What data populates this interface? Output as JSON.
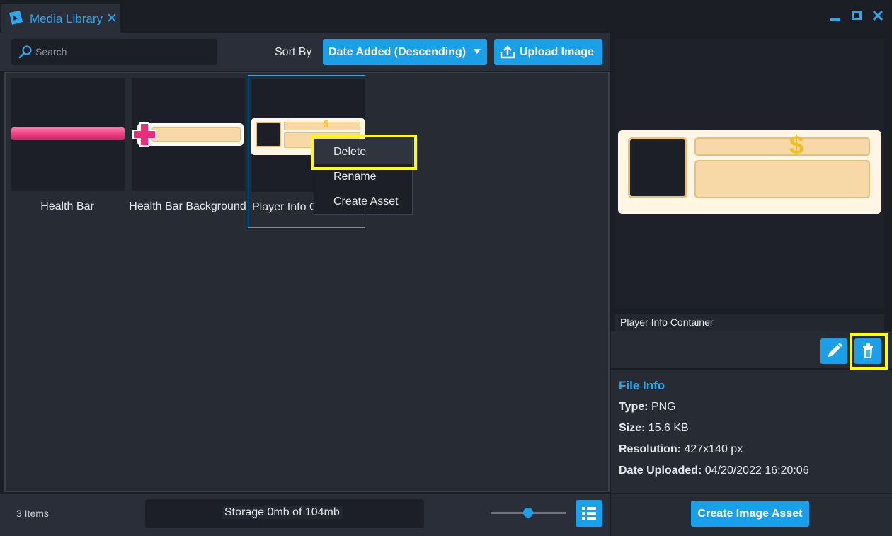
{
  "window": {
    "title": "Media Library",
    "close_glyph": "✕"
  },
  "toolbar": {
    "search_placeholder": "Search",
    "sort_label": "Sort By",
    "sort_value": "Date Added (Descending)",
    "upload_label": "Upload Image"
  },
  "assets": [
    {
      "label": "Health Bar"
    },
    {
      "label": "Health Bar Background"
    },
    {
      "label": "Player Info Container",
      "visible_label": "Player Info C"
    }
  ],
  "context_menu": {
    "items": [
      "Delete",
      "Rename",
      "Create Asset"
    ]
  },
  "footer": {
    "items_count": "3 Items",
    "storage": "Storage 0mb of 104mb",
    "zoom_level": 0.5
  },
  "preview": {
    "name": "Player Info Container"
  },
  "file_info": {
    "title": "File Info",
    "type_label": "Type:",
    "type_value": "PNG",
    "size_label": "Size:",
    "size_value": "15.6 KB",
    "resolution_label": "Resolution:",
    "resolution_value": "427x140 px",
    "date_label": "Date Uploaded:",
    "date_value": "04/20/2022 16:20:06"
  },
  "actions": {
    "create_label": "Create Image Asset",
    "edit_icon": "pencil-icon",
    "delete_icon": "trash-icon"
  },
  "colors": {
    "accent": "#1aa0e8",
    "highlight": "#ffff00",
    "health_bar": "#f0508c",
    "panel_fill": "#f6d9a6"
  }
}
